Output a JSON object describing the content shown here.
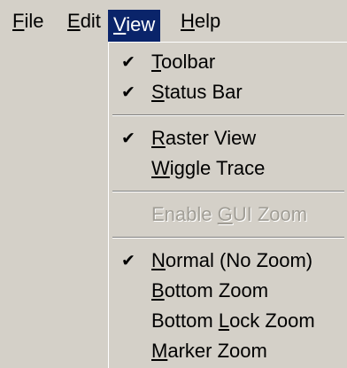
{
  "menubar": {
    "items": [
      {
        "pre": "",
        "accel": "F",
        "post": "ile"
      },
      {
        "pre": "",
        "accel": "E",
        "post": "dit"
      },
      {
        "pre": "",
        "accel": "V",
        "post": "iew"
      },
      {
        "pre": "",
        "accel": "H",
        "post": "elp"
      }
    ],
    "active_index": 2
  },
  "view_menu": {
    "check_glyph": "✔",
    "groups": [
      [
        {
          "pre": "",
          "accel": "T",
          "post": "oolbar",
          "checked": true,
          "enabled": true
        },
        {
          "pre": "",
          "accel": "S",
          "post": "tatus Bar",
          "checked": true,
          "enabled": true
        }
      ],
      [
        {
          "pre": "",
          "accel": "R",
          "post": "aster View",
          "checked": true,
          "enabled": true
        },
        {
          "pre": "",
          "accel": "W",
          "post": "iggle Trace",
          "checked": false,
          "enabled": true
        }
      ],
      [
        {
          "pre": "Enable ",
          "accel": "G",
          "post": "UI Zoom",
          "checked": false,
          "enabled": false
        }
      ],
      [
        {
          "pre": "",
          "accel": "N",
          "post": "ormal (No Zoom)",
          "checked": true,
          "enabled": true
        },
        {
          "pre": "",
          "accel": "B",
          "post": "ottom Zoom",
          "checked": false,
          "enabled": true
        },
        {
          "pre": "Bottom ",
          "accel": "L",
          "post": "ock Zoom",
          "checked": false,
          "enabled": true
        },
        {
          "pre": "",
          "accel": "M",
          "post": "arker Zoom",
          "checked": false,
          "enabled": true
        }
      ]
    ]
  }
}
